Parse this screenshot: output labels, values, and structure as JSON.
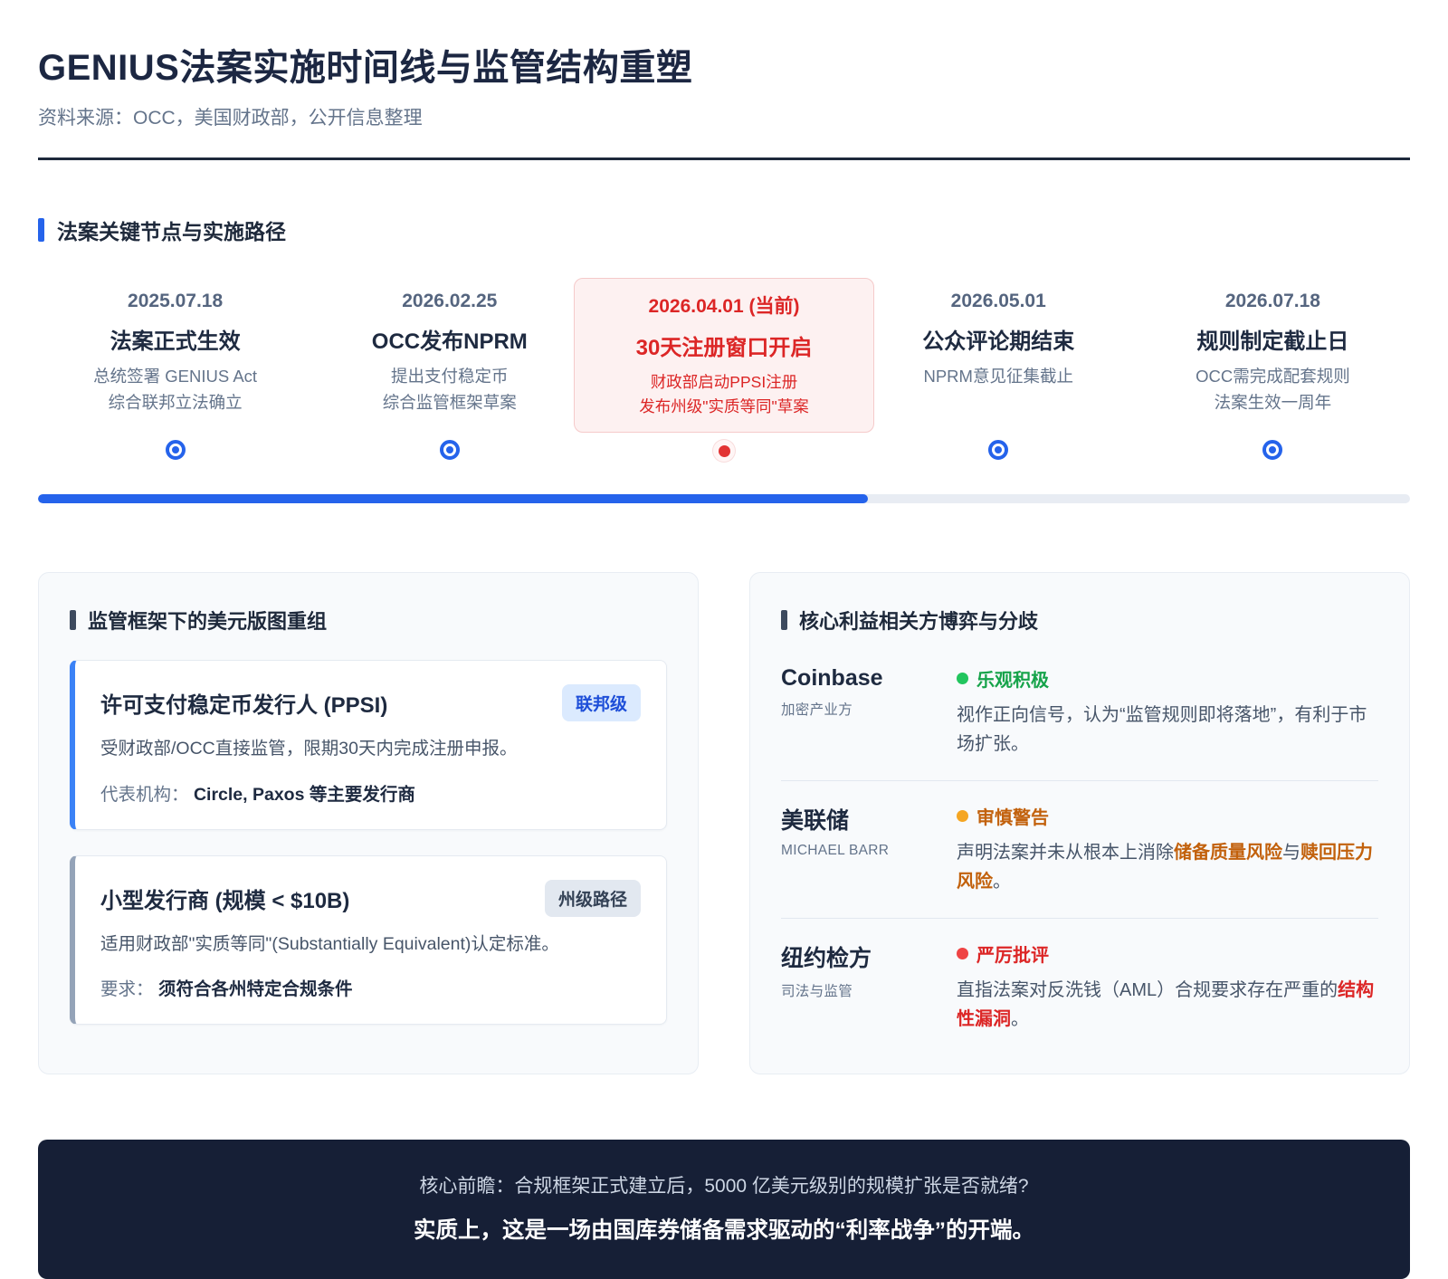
{
  "page": {
    "title": "GENIUS法案实施时间线与监管结构重塑",
    "source": "资料来源：OCC，美国财政部，公开信息整理"
  },
  "colors": {
    "accent_blue": "#2563eb",
    "dark_navy": "#1e293b",
    "alert_red": "#dc2626",
    "alert_red_bg": "#fdf1f1",
    "positive_green": "#16a34a",
    "caution_orange": "#c2610c",
    "caution_dot": "#f5a623",
    "negative_red": "#ef4444",
    "badge_federal_bg": "#dbeafe",
    "badge_federal_text": "#1d4ed8",
    "badge_state_bg": "#e2e8f0",
    "badge_state_text": "#334155",
    "footer_bg": "#161f36"
  },
  "timeline": {
    "section_title": "法案关键节点与实施路径",
    "progress_percent": 60.5,
    "items": [
      {
        "date": "2025.07.18",
        "title": "法案正式生效",
        "desc1": "总统签署 GENIUS Act",
        "desc2": "综合联邦立法确立"
      },
      {
        "date": "2026.02.25",
        "title": "OCC发布NPRM",
        "desc1": "提出支付稳定币",
        "desc2": "综合监管框架草案"
      },
      {
        "date": "2026.04.01 (当前)",
        "title": "30天注册窗口开启",
        "desc1": "财政部启动PPSI注册",
        "desc2": "发布州级\"实质等同\"草案"
      },
      {
        "date": "2026.05.01",
        "title": "公众评论期结束",
        "desc1": "NPRM意见征集截止",
        "desc2": ""
      },
      {
        "date": "2026.07.18",
        "title": "规则制定截止日",
        "desc1": "OCC需完成配套规则",
        "desc2": "法案生效一周年"
      }
    ]
  },
  "left_card": {
    "title": "监管框架下的美元版图重组",
    "issuers": [
      {
        "name": "许可支付稳定币发行人 (PPSI)",
        "badge": "联邦级",
        "desc": "受财政部/OCC直接监管，限期30天内完成注册申报。",
        "label": "代表机构：",
        "value": "Circle, Paxos 等主要发行商"
      },
      {
        "name": "小型发行商 (规模 < $10B)",
        "badge": "州级路径",
        "desc": "适用财政部\"实质等同\"(Substantially Equivalent)认定标准。",
        "label": "要求：",
        "value": "须符合各州特定合规条件"
      }
    ]
  },
  "right_card": {
    "title": "核心利益相关方博弈与分歧",
    "stakeholders": [
      {
        "name": "Coinbase",
        "role": "加密产业方",
        "stance": "乐观积极",
        "segments": [
          {
            "text": "视作正向信号，认为“监管规则即将落地”，有利于市场扩张。"
          }
        ]
      },
      {
        "name": "美联储",
        "role": "MICHAEL BARR",
        "stance": "审慎警告",
        "segments": [
          {
            "text": "声明法案并未从根本上消除"
          },
          {
            "text": "储备质量风险"
          },
          {
            "text": "与"
          },
          {
            "text": "赎回压力风险"
          },
          {
            "text": "。"
          }
        ]
      },
      {
        "name": "纽约检方",
        "role": "司法与监管",
        "stance": "严厉批评",
        "segments": [
          {
            "text": "直指法案对反洗钱（AML）合规要求存在严重的"
          },
          {
            "text": "结构性漏洞"
          },
          {
            "text": "。"
          }
        ]
      }
    ]
  },
  "footer": {
    "line1": "核心前瞻：合规框架正式建立后，5000 亿美元级别的规模扩张是否就绪?",
    "line2": "实质上，这是一场由国库券储备需求驱动的“利率战争”的开端。"
  }
}
